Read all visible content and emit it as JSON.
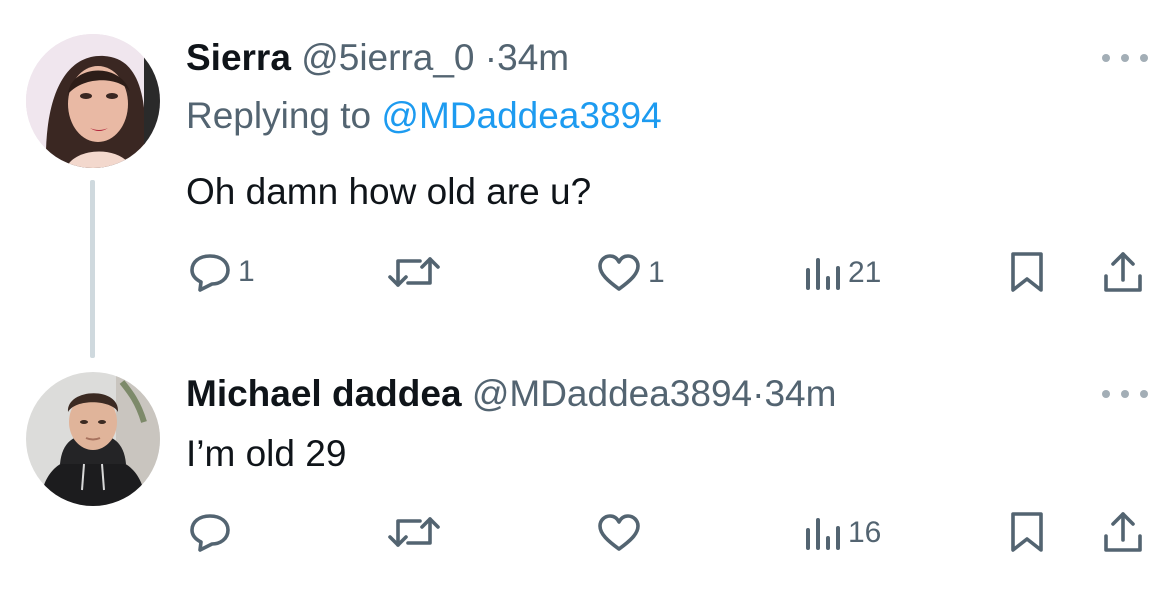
{
  "tweets": [
    {
      "display_name": "Sierra",
      "handle": "@5ierra_0",
      "separator": "·",
      "time": "34m",
      "replying_prefix": "Replying to",
      "replying_to": "@MDaddea3894",
      "text": "Oh damn how old are u?",
      "reply_count": "1",
      "retweet_count": "",
      "like_count": "1",
      "view_count": "21"
    },
    {
      "display_name": "Michael daddea",
      "handle": "@MDaddea3894",
      "separator": "·",
      "time": "34m",
      "text": "I’m old 29",
      "reply_count": "",
      "retweet_count": "",
      "like_count": "",
      "view_count": "16"
    }
  ],
  "colors": {
    "muted": "#536471",
    "link": "#1d9bf0",
    "thread_line": "#cfd9de",
    "text": "#0f1419"
  },
  "icons": [
    "reply-icon",
    "retweet-icon",
    "like-icon",
    "views-icon",
    "bookmark-icon",
    "share-icon",
    "more-icon"
  ]
}
